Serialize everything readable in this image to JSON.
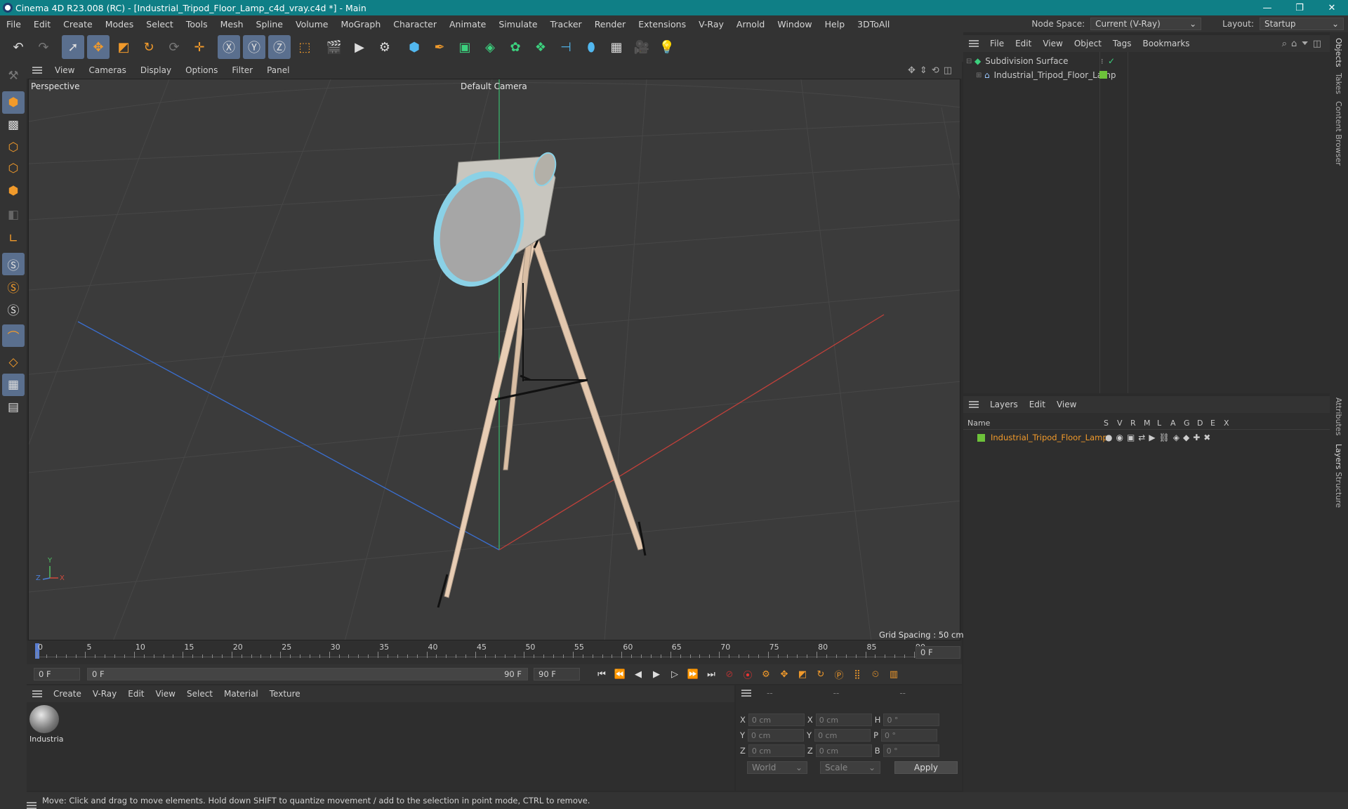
{
  "title": "Cinema 4D R23.008 (RC) - [Industrial_Tripod_Floor_Lamp_c4d_vray.c4d *] - Main",
  "window_controls": {
    "minimize": "—",
    "restore": "❐",
    "close": "✕"
  },
  "menu": [
    "File",
    "Edit",
    "Create",
    "Modes",
    "Select",
    "Tools",
    "Mesh",
    "Spline",
    "Volume",
    "MoGraph",
    "Character",
    "Animate",
    "Simulate",
    "Tracker",
    "Render",
    "Extensions",
    "V-Ray",
    "Arnold",
    "Window",
    "Help",
    "3DToAll"
  ],
  "node_space": {
    "label": "Node Space:",
    "value": "Current (V-Ray)"
  },
  "layout": {
    "label": "Layout:",
    "value": "Startup"
  },
  "viewport": {
    "menu": [
      "View",
      "Cameras",
      "Display",
      "Options",
      "Filter",
      "Panel"
    ],
    "label": "Perspective",
    "camera": "Default Camera",
    "grid_spacing": "Grid Spacing : 50 cm",
    "axis_labels": {
      "x": "X",
      "y": "Y",
      "z": "Z"
    }
  },
  "timeline": {
    "ticks": [
      "0",
      "5",
      "10",
      "15",
      "20",
      "25",
      "30",
      "35",
      "40",
      "45",
      "50",
      "55",
      "60",
      "65",
      "70",
      "75",
      "80",
      "85",
      "90"
    ],
    "current_frame": "0 F"
  },
  "frames": {
    "start": "0 F",
    "range_start": "0 F",
    "range_end": "90 F",
    "end": "90 F"
  },
  "material": {
    "menu": [
      "Create",
      "V-Ray",
      "Edit",
      "View",
      "Select",
      "Material",
      "Texture"
    ],
    "item_label": "Industria"
  },
  "coordinates": {
    "headers": [
      "--",
      "--",
      "--"
    ],
    "rows": [
      {
        "a": "X",
        "av": "0 cm",
        "b": "X",
        "bv": "0 cm",
        "c": "H",
        "cv": "0 °"
      },
      {
        "a": "Y",
        "av": "0 cm",
        "b": "Y",
        "bv": "0 cm",
        "c": "P",
        "cv": "0 °"
      },
      {
        "a": "Z",
        "av": "0 cm",
        "b": "Z",
        "bv": "0 cm",
        "c": "B",
        "cv": "0 °"
      }
    ],
    "world": "World",
    "scale": "Scale",
    "apply": "Apply"
  },
  "objects": {
    "menu": [
      "File",
      "Edit",
      "View",
      "Object",
      "Tags",
      "Bookmarks"
    ],
    "items": [
      "Subdivision Surface",
      "Industrial_Tripod_Floor_Lamp"
    ]
  },
  "layers": {
    "menu": [
      "Layers",
      "Edit",
      "View"
    ],
    "col_name": "Name",
    "cols": [
      "S",
      "V",
      "R",
      "M",
      "L",
      "A",
      "G",
      "D",
      "E",
      "X"
    ],
    "item": "Industrial_Tripod_Floor_Lamp"
  },
  "side_tabs": [
    "Objects",
    "Takes",
    "Content Browser",
    "Attributes",
    "Layers",
    "Structure"
  ],
  "status": "Move: Click and drag to move elements. Hold down SHIFT to quantize movement / add to the selection in point mode, CTRL to remove.",
  "colors": {
    "titlebar": "#0f7f86",
    "accent_orange": "#f19a2b",
    "layer_green": "#6dc23a",
    "selection_blue": "#5a6f8e"
  }
}
